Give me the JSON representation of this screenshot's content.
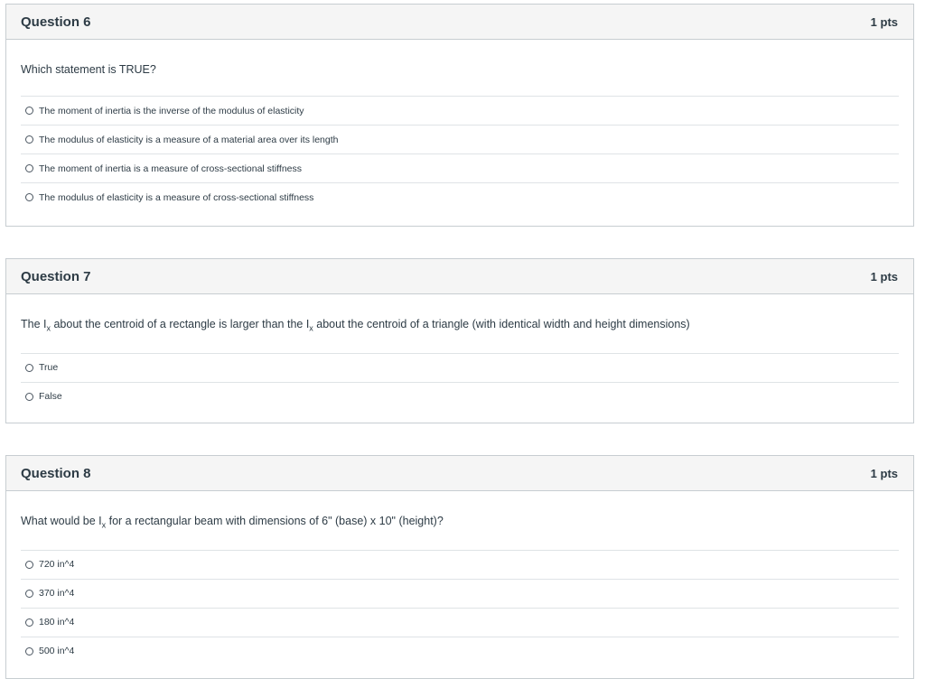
{
  "questions": [
    {
      "title": "Question 6",
      "points": "1 pts",
      "text_parts": [
        "Which statement is TRUE?"
      ],
      "answers": [
        "The moment of inertia is the inverse of the modulus of elasticity",
        "The modulus of elasticity is a measure of a material area over its length",
        "The moment of inertia is a measure of cross-sectional stiffness",
        "The modulus of elasticity is a measure of cross-sectional stiffness"
      ]
    },
    {
      "title": "Question 7",
      "points": "1 pts",
      "text_parts": [
        "The I",
        "x",
        " about the centroid of a rectangle is larger than the I",
        "x",
        " about the centroid of a triangle (with identical width and height dimensions)"
      ],
      "answers": [
        "True",
        "False"
      ]
    },
    {
      "title": "Question 8",
      "points": "1 pts",
      "text_parts": [
        "What would be I",
        "x",
        " for a rectangular  beam with dimensions of 6\" (base) x 10\" (height)?"
      ],
      "answers": [
        "720 in^4",
        "370 in^4",
        "180 in^4",
        "500 in^4"
      ]
    }
  ]
}
